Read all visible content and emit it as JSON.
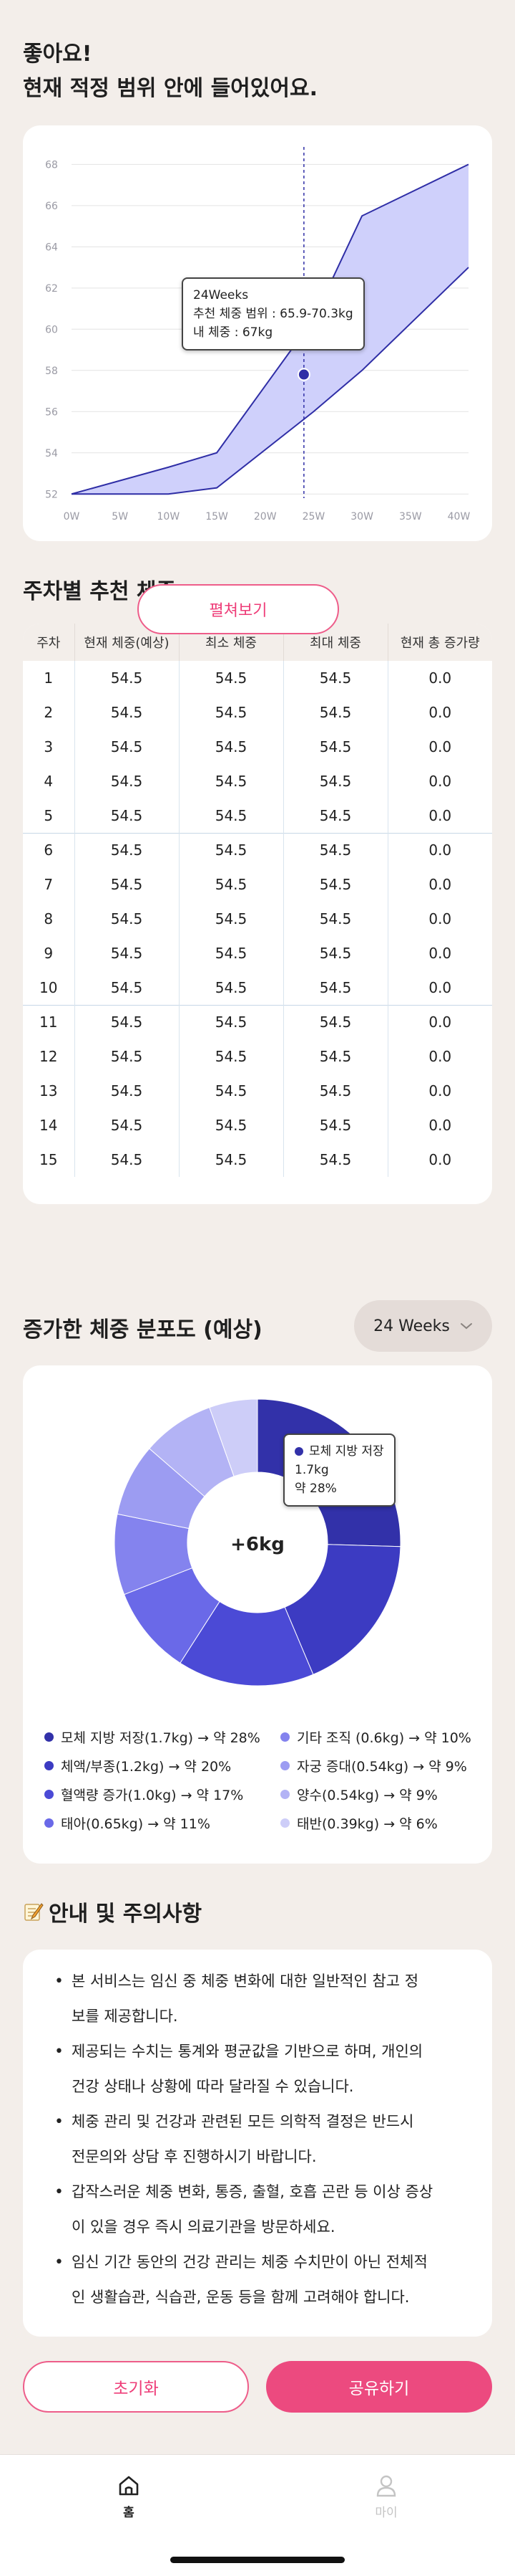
{
  "header": {
    "line1": "좋아요!",
    "line2": "현재 적정 범위 안에 들어있어요."
  },
  "chart_data": {
    "type": "area",
    "x_ticks": [
      "0W",
      "5W",
      "10W",
      "15W",
      "20W",
      "25W",
      "30W",
      "35W",
      "40W"
    ],
    "y_ticks": [
      52,
      54,
      56,
      58,
      60,
      62,
      64,
      66,
      68
    ],
    "ylim": [
      51.8,
      68.5
    ],
    "xlim": [
      0,
      41
    ],
    "range_min": [
      [
        0,
        52
      ],
      [
        10,
        52
      ],
      [
        15,
        52.3
      ],
      [
        25,
        56
      ],
      [
        30,
        58
      ],
      [
        41,
        63
      ]
    ],
    "range_max": [
      [
        0,
        52
      ],
      [
        10,
        53.3
      ],
      [
        15,
        54
      ],
      [
        25,
        60.5
      ],
      [
        30,
        65.5
      ],
      [
        41,
        68
      ]
    ],
    "current": {
      "x": 24,
      "y": 57.8
    },
    "marker_line_x": 24,
    "colors": {
      "band": "#cfd0fb",
      "band_line": "#2f2ea6",
      "marker": "#2f2ea6",
      "grid": "#e3e3e3",
      "tick": "#9a9aa4"
    }
  },
  "chart_tooltip": {
    "title": "24Weeks",
    "range": "추천 체중 범위 : 65.9-70.3kg",
    "mine": "내 체중 : 67kg"
  },
  "weekly": {
    "title": "주차별 추천 체중",
    "columns": [
      "주차",
      "현재 체중(예상)",
      "최소 체중",
      "최대 체중",
      "현재 총 증가량"
    ],
    "rows": [
      [
        "1",
        "54.5",
        "54.5",
        "54.5",
        "0.0"
      ],
      [
        "2",
        "54.5",
        "54.5",
        "54.5",
        "0.0"
      ],
      [
        "3",
        "54.5",
        "54.5",
        "54.5",
        "0.0"
      ],
      [
        "4",
        "54.5",
        "54.5",
        "54.5",
        "0.0"
      ],
      [
        "5",
        "54.5",
        "54.5",
        "54.5",
        "0.0"
      ],
      [
        "6",
        "54.5",
        "54.5",
        "54.5",
        "0.0"
      ],
      [
        "7",
        "54.5",
        "54.5",
        "54.5",
        "0.0"
      ],
      [
        "8",
        "54.5",
        "54.5",
        "54.5",
        "0.0"
      ],
      [
        "9",
        "54.5",
        "54.5",
        "54.5",
        "0.0"
      ],
      [
        "10",
        "54.5",
        "54.5",
        "54.5",
        "0.0"
      ],
      [
        "11",
        "54.5",
        "54.5",
        "54.5",
        "0.0"
      ],
      [
        "12",
        "54.5",
        "54.5",
        "54.5",
        "0.0"
      ],
      [
        "13",
        "54.5",
        "54.5",
        "54.5",
        "0.0"
      ],
      [
        "14",
        "54.5",
        "54.5",
        "54.5",
        "0.0"
      ],
      [
        "15",
        "54.5",
        "54.5",
        "54.5",
        "0.0"
      ]
    ],
    "expand_label": "펼쳐보기"
  },
  "distribution": {
    "title": "증가한 체중 분포도 (예상)",
    "week_select": "24 Weeks",
    "center_label": "+6kg",
    "tooltip": {
      "name": "모체 지방 저장",
      "value": "1.7kg",
      "pct": "약 28%"
    },
    "slices": [
      {
        "value": 28,
        "color": "#3231a9"
      },
      {
        "value": 20,
        "color": "#3c3bc2"
      },
      {
        "value": 17,
        "color": "#4b4ad6"
      },
      {
        "value": 11,
        "color": "#6a69e8"
      },
      {
        "value": 10,
        "color": "#8483ee"
      },
      {
        "value": 9,
        "color": "#9c9cf2"
      },
      {
        "value": 9,
        "color": "#b3b3f5"
      },
      {
        "value": 6,
        "color": "#cdcdf8"
      }
    ],
    "legend": [
      {
        "label": "모체 지방 저장(1.7kg) → 약 28%",
        "color": "#3231a9"
      },
      {
        "label": "기타 조직 (0.6kg) → 약 10%",
        "color": "#8483ee"
      },
      {
        "label": "체액/부종(1.2kg) → 약 20%",
        "color": "#3c3bc2"
      },
      {
        "label": "자궁 증대(0.54kg) → 약 9%",
        "color": "#9c9cf2"
      },
      {
        "label": "혈액량 증가(1.0kg) → 약 17%",
        "color": "#4b4ad6"
      },
      {
        "label": "양수(0.54kg) → 약 9%",
        "color": "#b3b3f5"
      },
      {
        "label": "태아(0.65kg) → 약 11%",
        "color": "#6a69e8"
      },
      {
        "label": "태반(0.39kg) → 약 6%",
        "color": "#cdcdf8"
      }
    ]
  },
  "notes": {
    "icon": "memo-icon",
    "title": "안내 및 주의사항",
    "lines": [
      [
        "본 서비스는 임신 중 체중 변화에 대한 일반적인 참고 정",
        "보를 제공합니다."
      ],
      [
        "제공되는 수치는 통계와 평균값을 기반으로 하며, 개인의",
        "건강 상태나 상황에 따라 달라질 수 있습니다."
      ],
      [
        "체중 관리 및 건강과 관련된 모든 의학적 결정은 반드시",
        "전문의와 상담 후 진행하시기 바랍니다."
      ],
      [
        "갑작스러운 체중 변화, 통증, 출혈, 호흡 곤란 등 이상 증상",
        "이 있을 경우 즉시 의료기관을 방문하세요."
      ],
      [
        "임신 기간 동안의 건강 관리는 체중 수치만이 아닌 전체적",
        "인 생활습관, 식습관, 운동 등을 함께 고려해야 합니다."
      ]
    ]
  },
  "actions": {
    "reset": "초기화",
    "share": "공유하기"
  },
  "nav": {
    "home": "홈",
    "my": "마이",
    "active_color": "#222222",
    "inactive_color": "#c4c4c4"
  }
}
